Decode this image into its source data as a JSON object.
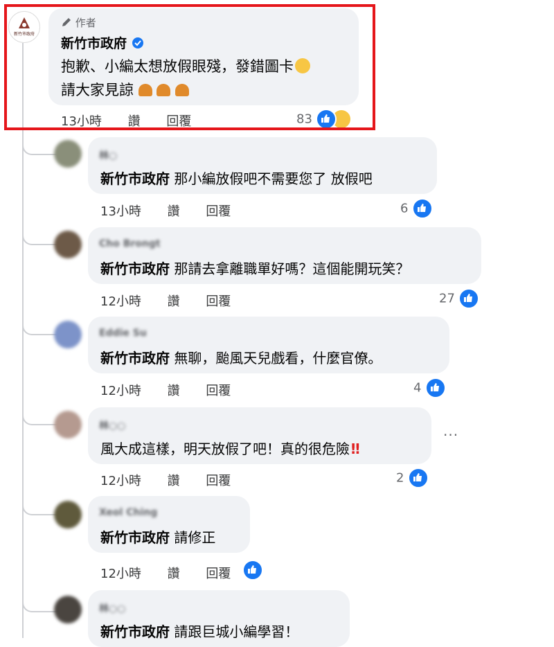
{
  "author_comment": {
    "badge": "作者",
    "name": "新竹市政府",
    "line1": "抱歉、小編太想放假眼殘，發錯圖卡",
    "line2": "請大家見諒",
    "time": "13小時",
    "like": "讚",
    "reply": "回覆",
    "reactions": "83",
    "logo_text": "新竹市政府"
  },
  "replies": [
    {
      "name": "林○",
      "tag": "新竹市政府",
      "text": "那小編放假吧不需要您了 放假吧",
      "time": "13小時",
      "like": "讚",
      "reply": "回覆",
      "count": "6"
    },
    {
      "name": "Cho Brongt",
      "tag": "新竹市政府",
      "text": "那請去拿離職單好嗎？這個能開玩笑？",
      "time": "12小時",
      "like": "讚",
      "reply": "回覆",
      "count": "27"
    },
    {
      "name": "Eddie Su",
      "tag": "新竹市政府",
      "text": "無聊，颱風天兒戲看，什麼官僚。",
      "time": "12小時",
      "like": "讚",
      "reply": "回覆",
      "count": "4"
    },
    {
      "name": "林○○",
      "tag": "",
      "text": "風大成這樣，明天放假了吧！真的很危險",
      "time": "12小時",
      "like": "讚",
      "reply": "回覆",
      "count": "2"
    },
    {
      "name": "Xeol Ching",
      "tag": "新竹市政府",
      "text": "請修正",
      "time": "12小時",
      "like": "讚",
      "reply": "回覆",
      "count": ""
    },
    {
      "name": "林○○",
      "tag": "新竹市政府",
      "text": "請跟巨城小編學習！",
      "time": "",
      "like": "",
      "reply": "",
      "count": ""
    }
  ],
  "colors": {
    "accent": "#1877f2",
    "highlight": "#e5161b",
    "bubble": "#f0f2f5"
  }
}
